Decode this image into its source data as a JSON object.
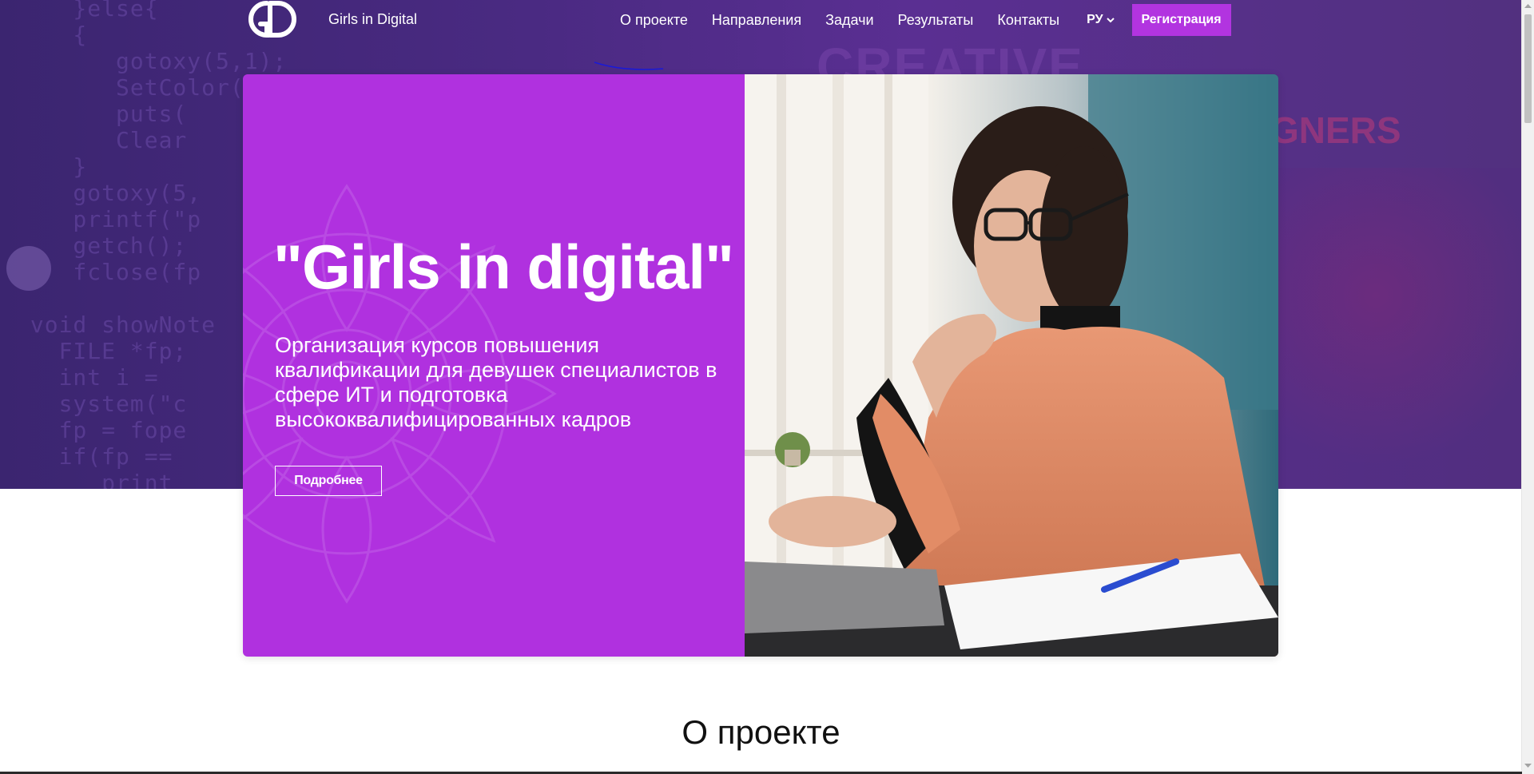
{
  "brand": {
    "name": "Girls in Digital"
  },
  "nav": {
    "items": [
      {
        "label": "О проекте"
      },
      {
        "label": "Направления"
      },
      {
        "label": "Задачи"
      },
      {
        "label": "Результаты"
      },
      {
        "label": "Контакты"
      }
    ],
    "language": "РУ",
    "register_label": "Регистрация"
  },
  "hero": {
    "title": "\"Girls in digital\"",
    "subtitle": "Организация курсов повышения квалификации для девушек специалистов в сфере ИТ и подготовка высококвалифицированных кадров",
    "more_label": "Подробнее"
  },
  "background": {
    "code_text": "    }else{\n    {\n       gotoxy(5,1);\n       SetColor(...);\n       puts(\n       Clear\n    }\n    gotoxy(5,\n    printf(\"p\n    getch();\n    fclose(fp\n\n void showNote\n   FILE *fp;\n   int i =\n   system(\"c\n   fp = fope\n   if(fp ==\n      print",
    "creative_word": "CREATIVE",
    "designers_word": "GNERS"
  },
  "sections": {
    "about_title": "О проекте"
  },
  "colors": {
    "accent": "#b234e0",
    "hero_card": "#b031df",
    "hero_band": "#4a2a82"
  },
  "icons": {
    "language_chevron": "chevron-down-icon",
    "logo": "gd-logo-icon"
  }
}
